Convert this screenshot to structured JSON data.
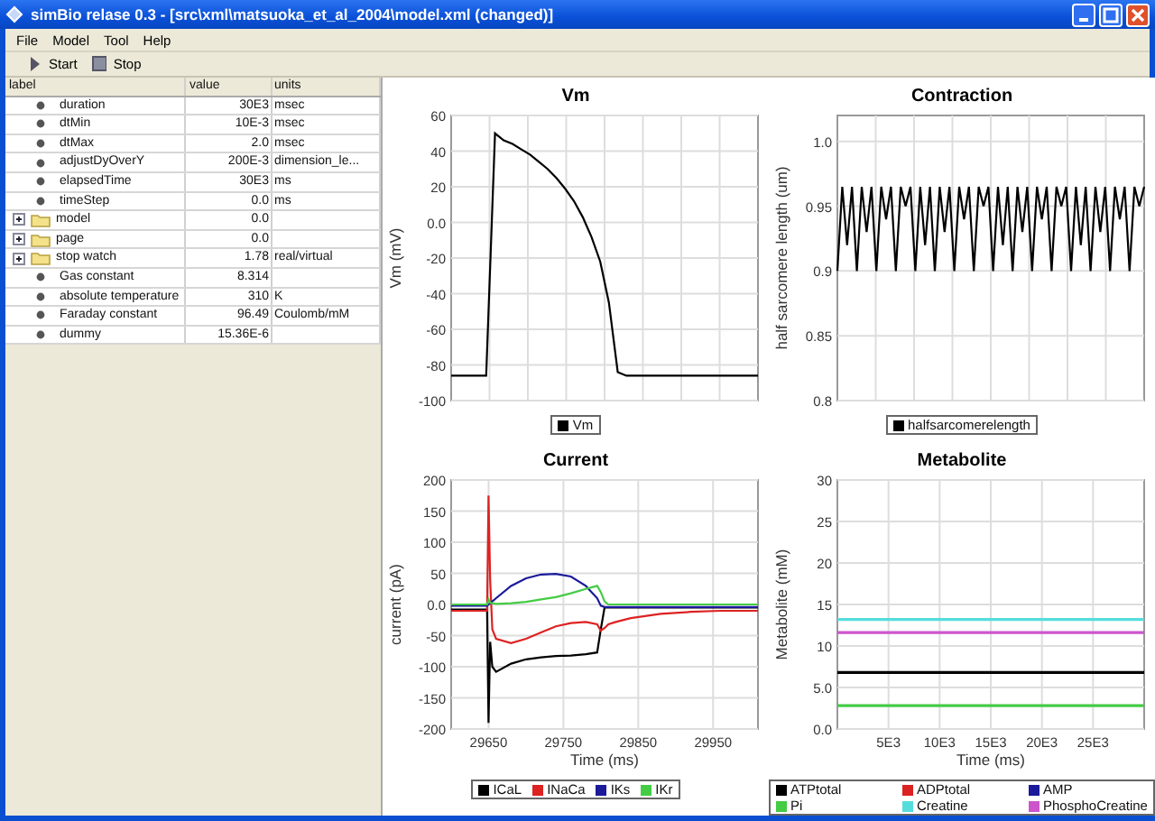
{
  "window": {
    "title": "simBio relase 0.3  - [src\\xml\\matsuoka_et_al_2004\\model.xml (changed)]"
  },
  "menu": [
    "File",
    "Model",
    "Tool",
    "Help"
  ],
  "toolbar": [
    {
      "label": "Start",
      "kind": "play"
    },
    {
      "label": "Stop",
      "kind": "stop"
    }
  ],
  "table": {
    "columns": [
      "label",
      "value",
      "units"
    ],
    "rows": [
      {
        "kind": "leaf",
        "label": "duration",
        "value": "30E3",
        "units": "msec"
      },
      {
        "kind": "leaf",
        "label": "dtMin",
        "value": "10E-3",
        "units": "msec"
      },
      {
        "kind": "leaf",
        "label": "dtMax",
        "value": "2.0",
        "units": "msec"
      },
      {
        "kind": "leaf",
        "label": "adjustDyOverY",
        "value": "200E-3",
        "units": "dimension_le..."
      },
      {
        "kind": "leaf",
        "label": "elapsedTime",
        "value": "30E3",
        "units": "ms"
      },
      {
        "kind": "leaf",
        "label": "timeStep",
        "value": "0.0",
        "units": "ms"
      },
      {
        "kind": "folder",
        "label": "model",
        "value": "0.0"
      },
      {
        "kind": "folder",
        "label": "page",
        "value": "0.0"
      },
      {
        "kind": "folder",
        "label": "stop watch",
        "value": "1.78",
        "units": "real/virtual"
      },
      {
        "kind": "leaf",
        "label": "Gas constant",
        "value": "8.314"
      },
      {
        "kind": "leaf",
        "label": "absolute temperature",
        "value": "310",
        "units": "K"
      },
      {
        "kind": "leaf",
        "label": "Faraday constant",
        "value": "96.49",
        "units": "Coulomb/mM"
      },
      {
        "kind": "leaf",
        "label": "dummy",
        "value": "15.36E-6"
      }
    ]
  },
  "charts": [
    {
      "chart_data": {
        "type": "line",
        "grid": true,
        "legend": "bottom",
        "title": "Vm",
        "ylabel": "Vm (mV)",
        "ylim": [
          -100,
          60
        ],
        "yticks": [
          60,
          40,
          20,
          {
            "value": 0,
            "label": "0.0"
          },
          -20,
          -40,
          -60,
          -80,
          -100
        ],
        "series": [
          {
            "name": "Vm",
            "color": "#000000",
            "values": [
              -86,
              -86,
              -86,
              -86,
              -86,
              50,
              46,
              44,
              41,
              38,
              34,
              30,
              25,
              19,
              12,
              3,
              -8,
              -22,
              -45,
              -84,
              -86,
              -86,
              -86,
              -86,
              -86,
              -86,
              -86,
              -86,
              -86,
              -86,
              -86,
              -86,
              -86,
              -86,
              -86,
              -86
            ]
          }
        ]
      }
    },
    {
      "chart_data": {
        "type": "line",
        "grid": true,
        "legend": "bottom",
        "title": "Contraction",
        "ylabel": "half sarcomere length (um)",
        "ylim": [
          0.8,
          1.02
        ],
        "yticks": [
          {
            "value": 1.0,
            "label": "1.0"
          },
          0.95,
          0.9,
          0.85,
          {
            "value": 0.8,
            "label": "0.8"
          }
        ],
        "series": [
          {
            "name": "halfsarcomerelength",
            "color": "#000000",
            "values": [
              0.9,
              0.965,
              0.92,
              0.965,
              0.9,
              0.965,
              0.93,
              0.965,
              0.9,
              0.965,
              0.94,
              0.965,
              0.9,
              0.965,
              0.95,
              0.965,
              0.9,
              0.965,
              0.92,
              0.965,
              0.9,
              0.965,
              0.93,
              0.965,
              0.9,
              0.965,
              0.94,
              0.965,
              0.9,
              0.965,
              0.95,
              0.965,
              0.9,
              0.965,
              0.92,
              0.965,
              0.9,
              0.965,
              0.93,
              0.965,
              0.9,
              0.965,
              0.94,
              0.965,
              0.9,
              0.965,
              0.95,
              0.965,
              0.9,
              0.965,
              0.92,
              0.965,
              0.9,
              0.965,
              0.93,
              0.965,
              0.9,
              0.965,
              0.94,
              0.965,
              0.9,
              0.965,
              0.95,
              0.965
            ]
          }
        ]
      }
    },
    {
      "chart_data": {
        "type": "line",
        "grid": true,
        "legend": "bottom",
        "title": "Current",
        "xlabel": "Time (ms)",
        "ylabel": "current (pA)",
        "xlim": [
          29600,
          30010
        ],
        "ylim": [
          -200,
          200
        ],
        "xticks": [
          29650,
          29750,
          29850,
          29950
        ],
        "yticks": [
          200,
          150,
          100,
          50,
          {
            "value": 0,
            "label": "0.0"
          },
          -50,
          -100,
          -150,
          -200
        ],
        "x": [
          29600,
          29648,
          29650,
          29652,
          29655,
          29660,
          29680,
          29700,
          29720,
          29740,
          29760,
          29780,
          29795,
          29800,
          29805,
          29810,
          29820,
          29840,
          29880,
          29920,
          29960,
          30010
        ],
        "series": [
          {
            "name": "ICaL",
            "color": "#000000",
            "values": [
              -8,
              -8,
              -190,
              -60,
              -100,
              -108,
              -95,
              -88,
              -85,
              -83,
              -82,
              -80,
              -77,
              -40,
              -5,
              -5,
              -5,
              -5,
              -5,
              -5,
              -5,
              -5
            ]
          },
          {
            "name": "INaCa",
            "color": "#dd2222",
            "values": [
              -10,
              -10,
              175,
              40,
              -40,
              -55,
              -62,
              -55,
              -45,
              -35,
              -30,
              -28,
              -32,
              -42,
              -38,
              -32,
              -28,
              -22,
              -15,
              -12,
              -10,
              -10
            ]
          },
          {
            "name": "IKs",
            "color": "#1a1a9a",
            "values": [
              -2,
              -2,
              0,
              2,
              5,
              10,
              30,
              42,
              48,
              49,
              45,
              30,
              10,
              -2,
              -4,
              -4,
              -4,
              -4,
              -4,
              -4,
              -4,
              -4
            ]
          },
          {
            "name": "IKr",
            "color": "#44cc44",
            "values": [
              0,
              0,
              8,
              3,
              2,
              1,
              2,
              4,
              8,
              12,
              18,
              25,
              30,
              20,
              5,
              0,
              0,
              0,
              0,
              0,
              0,
              0
            ]
          }
        ]
      }
    },
    {
      "chart_data": {
        "type": "line",
        "grid": true,
        "legend": "bottom",
        "title": "Metabolite",
        "xlabel": "Time (ms)",
        "ylabel": "Metabolite (mM)",
        "xlim": [
          0,
          30000
        ],
        "ylim": [
          0,
          30
        ],
        "xticks": [
          {
            "value": 5000,
            "label": "5E3"
          },
          {
            "value": 10000,
            "label": "10E3"
          },
          {
            "value": 15000,
            "label": "15E3"
          },
          {
            "value": 20000,
            "label": "20E3"
          },
          {
            "value": 25000,
            "label": "25E3"
          }
        ],
        "yticks": [
          30,
          25,
          20,
          15,
          10,
          {
            "value": 5,
            "label": "5.0"
          },
          {
            "value": 0,
            "label": "0.0"
          }
        ],
        "x": [
          0,
          30000
        ],
        "series": [
          {
            "name": "ATPtotal",
            "color": "#000000",
            "values": [
              6.8,
              6.8
            ]
          },
          {
            "name": "ADPtotal",
            "color": "#dd2222",
            "values": [
              null,
              null
            ]
          },
          {
            "name": "AMP",
            "color": "#1a1a9a",
            "values": [
              null,
              null
            ]
          },
          {
            "name": "Pi",
            "color": "#44cc44",
            "values": [
              2.8,
              2.8
            ]
          },
          {
            "name": "Creatine",
            "color": "#55dddd",
            "values": [
              13.2,
              13.2
            ]
          },
          {
            "name": "PhosphoCreatine",
            "color": "#cc55cc",
            "values": [
              11.6,
              11.6
            ]
          }
        ]
      }
    }
  ]
}
